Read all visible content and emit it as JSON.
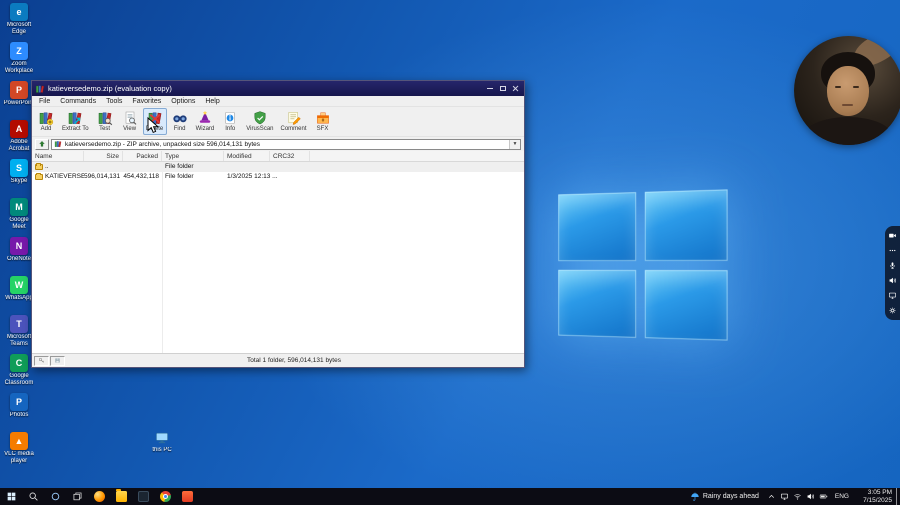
{
  "desktop": {
    "icons": [
      {
        "label": "Microsoft Edge",
        "icon": "edge",
        "color": "#0b7bc0",
        "glyph": "e"
      },
      {
        "label": "Zoom Workplace",
        "icon": "zoom",
        "color": "#2d8cff",
        "glyph": "Z"
      },
      {
        "label": "PowerPoint",
        "icon": "powerpoint",
        "color": "#d24726",
        "glyph": "P"
      },
      {
        "label": "Adobe Acrobat",
        "icon": "acrobat",
        "color": "#b30b00",
        "glyph": "A"
      },
      {
        "label": "Skype",
        "icon": "skype",
        "color": "#00aff0",
        "glyph": "S"
      },
      {
        "label": "Google Meet",
        "icon": "meet",
        "color": "#00897b",
        "glyph": "M"
      },
      {
        "label": "OneNote",
        "icon": "onenote",
        "color": "#7719aa",
        "glyph": "N"
      },
      {
        "label": "WhatsApp",
        "icon": "whatsapp",
        "color": "#25d366",
        "glyph": "W"
      },
      {
        "label": "Microsoft Teams",
        "icon": "teams",
        "color": "#4b53bc",
        "glyph": "T"
      },
      {
        "label": "Google Classroom",
        "icon": "classroom",
        "color": "#0f9d58",
        "glyph": "C"
      },
      {
        "label": "Photos",
        "icon": "photos",
        "color": "#1565c0",
        "glyph": "P"
      },
      {
        "label": "VLC media player",
        "icon": "vlc",
        "color": "#f57c00",
        "glyph": "▲"
      }
    ],
    "this_pc_label": "this PC"
  },
  "winrar": {
    "title": "katieversedemo.zip (evaluation copy)",
    "menu": [
      "File",
      "Commands",
      "Tools",
      "Favorites",
      "Options",
      "Help"
    ],
    "toolbar": [
      {
        "label": "Add",
        "icon": "add"
      },
      {
        "label": "Extract To",
        "icon": "extract"
      },
      {
        "label": "Test",
        "icon": "test"
      },
      {
        "label": "View",
        "icon": "view"
      },
      {
        "label": "Delete",
        "icon": "delete",
        "active": "true"
      },
      {
        "label": "Find",
        "icon": "find"
      },
      {
        "label": "Wizard",
        "icon": "wizard"
      },
      {
        "label": "Info",
        "icon": "info"
      },
      {
        "label": "VirusScan",
        "icon": "virus"
      },
      {
        "label": "Comment",
        "icon": "comment"
      },
      {
        "label": "SFX",
        "icon": "sfx"
      }
    ],
    "address": "katieversedemo.zip - ZIP archive, unpacked size 596,014,131 bytes",
    "columns": [
      "Name",
      "Size",
      "Packed",
      "Type",
      "Modified",
      "CRC32"
    ],
    "rows": [
      {
        "name": "..",
        "size": "",
        "packed": "",
        "type": "File folder",
        "modified": "",
        "crc": ""
      },
      {
        "name": "KATIEVERSE",
        "size": "596,014,131",
        "packed": "454,432,118",
        "type": "File folder",
        "modified": "1/3/2025 12:13 ...",
        "crc": ""
      }
    ],
    "status_total": "Total 1 folder, 596,014,131 bytes"
  },
  "overlay": {
    "side_tools": [
      {
        "name": "camera",
        "icon": "camera"
      },
      {
        "name": "more-options",
        "icon": "dots"
      },
      {
        "name": "microphone",
        "icon": "mic"
      },
      {
        "name": "speaker",
        "icon": "speaker"
      },
      {
        "name": "display",
        "icon": "display"
      },
      {
        "name": "settings",
        "icon": "gear"
      }
    ]
  },
  "taskbar": {
    "system_icons": [
      {
        "name": "start",
        "icon": "win"
      },
      {
        "name": "search",
        "icon": "search"
      },
      {
        "name": "cortana",
        "icon": "cortana"
      },
      {
        "name": "task-view",
        "icon": "taskview"
      }
    ],
    "apps": [
      {
        "name": "firefox"
      },
      {
        "name": "file-explorer"
      },
      {
        "name": "terminal"
      },
      {
        "name": "chrome"
      },
      {
        "name": "brave"
      }
    ],
    "weather_label": "Rainy days ahead",
    "tray_icons": [
      {
        "name": "hidden-icons",
        "icon": "chevup"
      },
      {
        "name": "display",
        "icon": "display"
      },
      {
        "name": "network",
        "icon": "wifi"
      },
      {
        "name": "volume",
        "icon": "speaker"
      },
      {
        "name": "battery",
        "icon": "battery"
      }
    ],
    "language": "ENG",
    "time": "3:05 PM",
    "date": "7/15/2025"
  }
}
